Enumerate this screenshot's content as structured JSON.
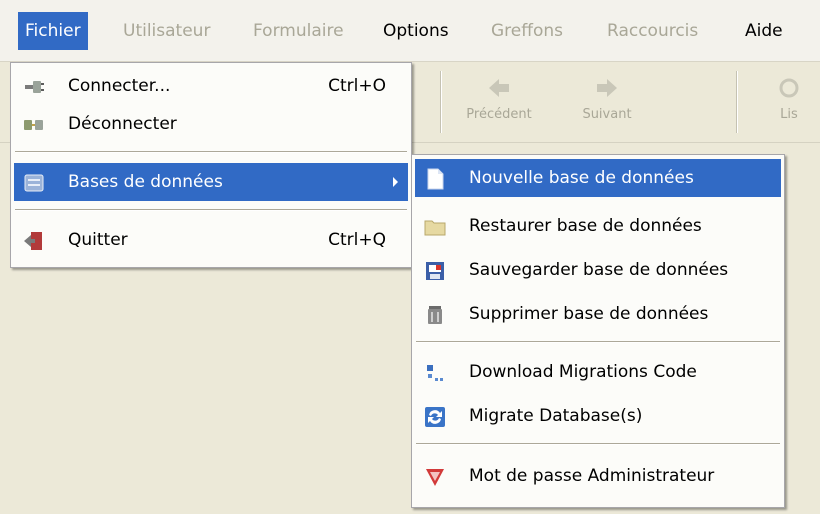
{
  "menubar": {
    "items": [
      {
        "label": "Fichier",
        "state": "active"
      },
      {
        "label": "Utilisateur",
        "state": "disabled"
      },
      {
        "label": "Formulaire",
        "state": "disabled"
      },
      {
        "label": "Options",
        "state": "enabled"
      },
      {
        "label": "Greffons",
        "state": "disabled"
      },
      {
        "label": "Raccourcis",
        "state": "disabled"
      },
      {
        "label": "Aide",
        "state": "enabled"
      }
    ]
  },
  "toolbar": {
    "buttons": [
      {
        "label": "Précédent",
        "icon": "arrow-left-icon"
      },
      {
        "label": "Suivant",
        "icon": "arrow-right-icon"
      },
      {
        "label": "Lis",
        "icon": "refresh-icon"
      }
    ]
  },
  "fichier_menu": {
    "items": [
      {
        "label": "Connecter...",
        "shortcut": "Ctrl+O",
        "icon": "connect-plug-icon"
      },
      {
        "label": "Déconnecter",
        "shortcut": "",
        "icon": "disconnect-plug-icon"
      },
      {
        "label": "Bases de données",
        "shortcut": "",
        "icon": "database-icon",
        "submenu": true,
        "selected": true
      },
      {
        "label": "Quitter",
        "shortcut": "Ctrl+Q",
        "icon": "exit-door-icon"
      }
    ]
  },
  "bdd_menu": {
    "items": [
      {
        "label": "Nouvelle base de données",
        "icon": "new-document-icon",
        "selected": true
      },
      {
        "label": "Restaurer base de données",
        "icon": "folder-icon"
      },
      {
        "label": "Sauvegarder base de données",
        "icon": "save-calendar-icon"
      },
      {
        "label": "Supprimer base de données",
        "icon": "trash-can-icon"
      },
      {
        "label": "Download Migrations Code",
        "icon": "download-icon"
      },
      {
        "label": "Migrate Database(s)",
        "icon": "migrate-sync-icon"
      },
      {
        "label": "Mot de passe Administrateur",
        "icon": "shield-key-icon"
      }
    ]
  },
  "colors": {
    "selection": "#316ac5",
    "menu_background": "#fcfcf9",
    "disabled_text": "#a9a797",
    "window_background": "#ece9d8"
  }
}
